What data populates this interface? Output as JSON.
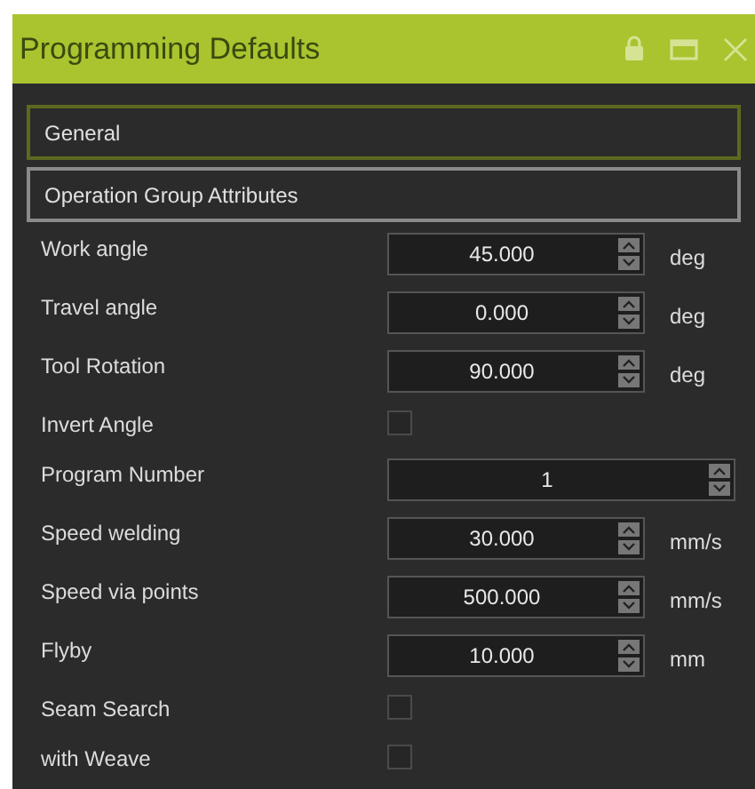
{
  "window": {
    "title": "Programming Defaults"
  },
  "sections": [
    {
      "label": "General",
      "selected": true
    },
    {
      "label": "Operation Group Attributes",
      "selected": false
    }
  ],
  "fields": [
    {
      "kind": "spinner",
      "label": "Work angle",
      "value": "45.000",
      "unit": "deg"
    },
    {
      "kind": "spinner",
      "label": "Travel angle",
      "value": "0.000",
      "unit": "deg"
    },
    {
      "kind": "spinner",
      "label": "Tool Rotation",
      "value": "90.000",
      "unit": "deg"
    },
    {
      "kind": "checkbox",
      "label": "Invert Angle",
      "checked": false
    },
    {
      "kind": "spinner",
      "label": "Program Number",
      "value": "1"
    },
    {
      "kind": "spinner",
      "label": "Speed welding",
      "value": "30.000",
      "unit": "mm/s"
    },
    {
      "kind": "spinner",
      "label": "Speed via points",
      "value": "500.000",
      "unit": "mm/s"
    },
    {
      "kind": "spinner",
      "label": "Flyby",
      "value": "10.000",
      "unit": "mm"
    },
    {
      "kind": "checkbox",
      "label": "Seam Search",
      "checked": false
    },
    {
      "kind": "checkbox",
      "label": "with Weave",
      "checked": false
    }
  ]
}
